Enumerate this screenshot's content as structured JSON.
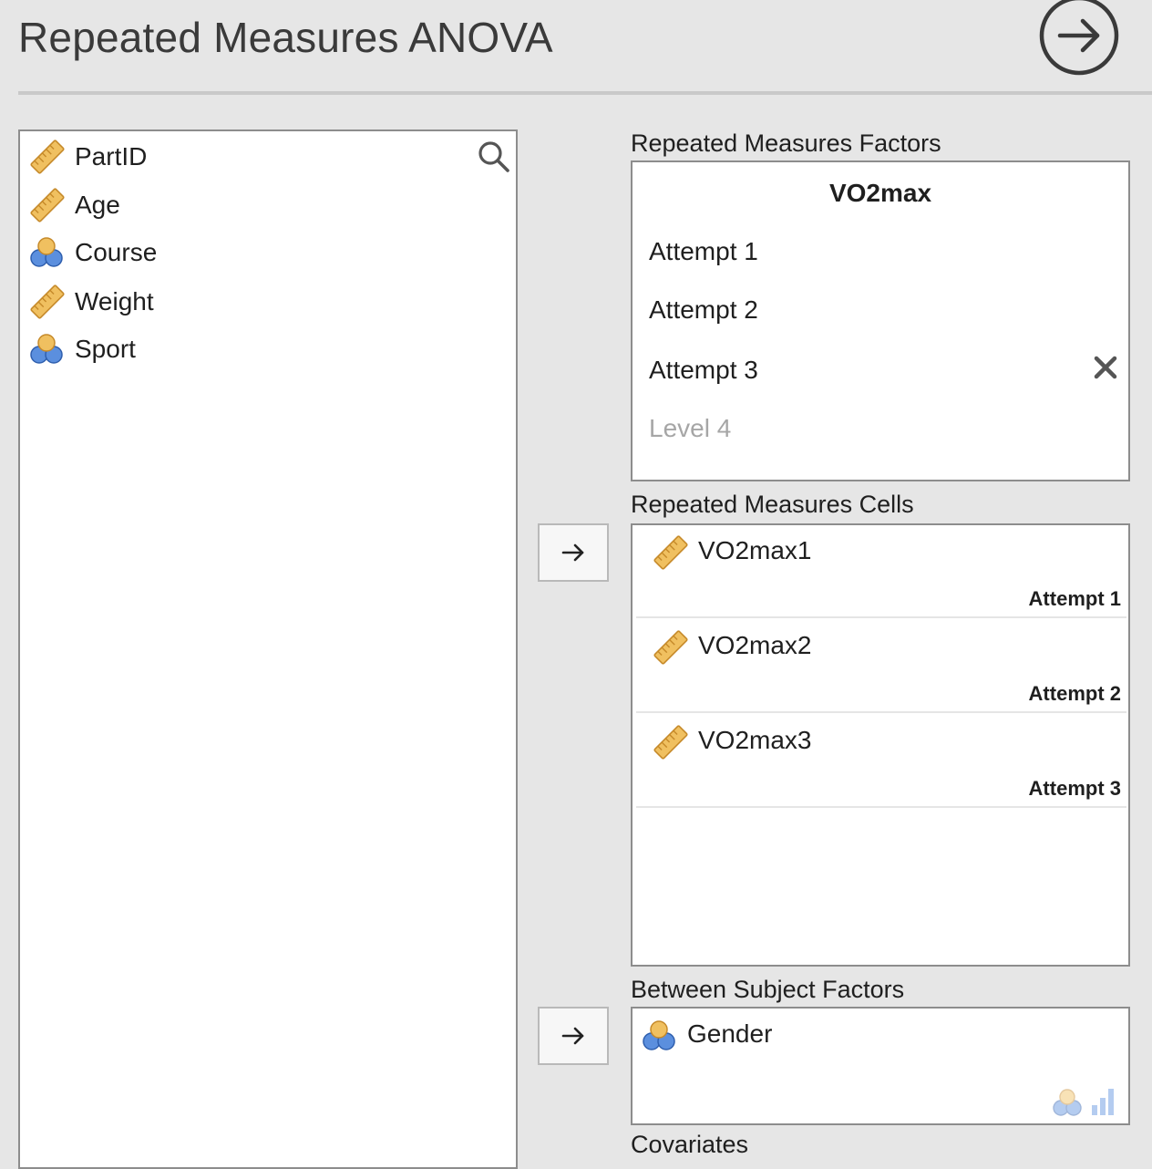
{
  "header": {
    "title": "Repeated Measures ANOVA",
    "run_icon": "arrow-circle-right-icon"
  },
  "variables": {
    "search_icon": "search-icon",
    "items": [
      {
        "label": "PartID",
        "type": "continuous",
        "icon": "ruler-icon"
      },
      {
        "label": "Age",
        "type": "continuous",
        "icon": "ruler-icon"
      },
      {
        "label": "Course",
        "type": "nominal",
        "icon": "nominal-circles-icon"
      },
      {
        "label": "Weight",
        "type": "continuous",
        "icon": "ruler-icon"
      },
      {
        "label": "Sport",
        "type": "nominal",
        "icon": "nominal-circles-icon"
      }
    ]
  },
  "rm_factors": {
    "label": "Repeated Measures Factors",
    "factor_name": "VO2max",
    "levels": [
      "Attempt 1",
      "Attempt 2",
      "Attempt 3"
    ],
    "new_level_placeholder": "Level 4",
    "remove_icon": "close-icon"
  },
  "rm_cells": {
    "label": "Repeated Measures Cells",
    "cells": [
      {
        "variable": "VO2max1",
        "level": "Attempt 1"
      },
      {
        "variable": "VO2max2",
        "level": "Attempt 2"
      },
      {
        "variable": "VO2max3",
        "level": "Attempt 3"
      }
    ]
  },
  "between_factors": {
    "label": "Between Subject Factors",
    "items": [
      {
        "variable": "Gender",
        "icon": "nominal-circles-icon"
      }
    ]
  },
  "covariates": {
    "label": "Covariates"
  },
  "buttons": {
    "move_icon": "arrow-right-icon"
  },
  "colors": {
    "ruler": "#f0c060",
    "ruler_stroke": "#c68a2a",
    "nominal_orange": "#f0c060",
    "nominal_blue": "#5b8fde",
    "background": "#e6e6e6"
  }
}
